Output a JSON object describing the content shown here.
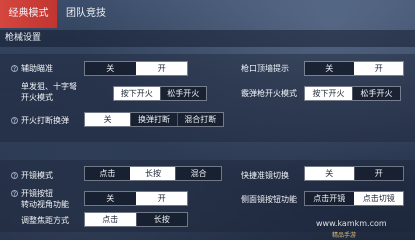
{
  "tabs": [
    {
      "label": "经典模式",
      "active": true
    },
    {
      "label": "团队竞技",
      "active": false
    }
  ],
  "section_title": "枪械设置",
  "settings": {
    "aim_assist": {
      "label": "辅助瞄准",
      "options": [
        "关",
        "开"
      ],
      "selected": 1
    },
    "muzzle_hint": {
      "label": "枪口顶墙提示",
      "options": [
        "关",
        "开"
      ],
      "selected": 1
    },
    "single_fire": {
      "label_line1": "单发狙、十字弩",
      "label_line2": "开火模式",
      "options": [
        "按下开火",
        "松手开火"
      ],
      "selected": 0
    },
    "shotgun_fire": {
      "label": "霰弹枪开火模式",
      "options": [
        "按下开火",
        "松手开火"
      ],
      "selected": 0
    },
    "fire_interrupt": {
      "label": "开火打断换弹",
      "options": [
        "关",
        "换弹打断",
        "混合打断"
      ],
      "selected": 0
    },
    "scope_mode": {
      "label": "开镜模式",
      "options": [
        "点击",
        "长按",
        "混合"
      ],
      "selected": 1
    },
    "quick_scope": {
      "label": "快捷准镜切换",
      "options": [
        "关",
        "开"
      ],
      "selected": 0
    },
    "scope_button": {
      "label_line1": "开镜按钮",
      "label_line2": "转动视角功能",
      "options": [
        "关",
        "开"
      ],
      "selected": 1
    },
    "side_scope": {
      "label": "侧面镜按钮功能",
      "options": [
        "点击开镜",
        "点击切镜"
      ],
      "selected": 1
    },
    "focus_mode": {
      "label": "调整焦距方式",
      "options": [
        "点击",
        "长按"
      ],
      "selected": 0
    }
  },
  "watermark": {
    "url": "www.kamkm.com",
    "sub": "精品手游"
  },
  "colors": {
    "active_tab": "#d4463e",
    "selected_option": "#ffffff",
    "background": "#2c3b55"
  }
}
